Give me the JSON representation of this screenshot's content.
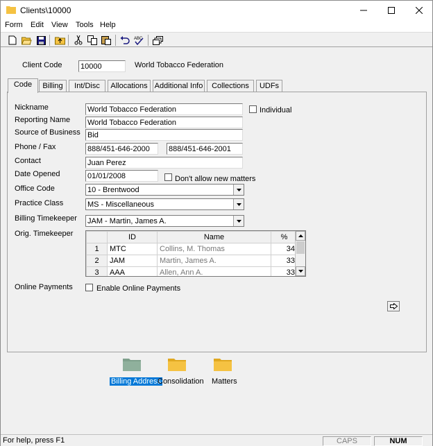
{
  "window": {
    "title": "Clients\\10000"
  },
  "menu": [
    "Form",
    "Edit",
    "View",
    "Tools",
    "Help"
  ],
  "header": {
    "client_code_label": "Client Code",
    "client_code_value": "10000",
    "client_name": "World Tobacco Federation"
  },
  "tabs": [
    "Code",
    "Billing",
    "Int/Disc",
    "Allocations",
    "Additional Info",
    "Collections",
    "UDFs"
  ],
  "form": {
    "nickname_label": "Nickname",
    "nickname_value": "World Tobacco Federation",
    "individual_label": "Individual",
    "reporting_label": "Reporting Name",
    "reporting_value": "World Tobacco Federation",
    "source_label": "Source of Business",
    "source_value": "Bid",
    "phone_label": "Phone / Fax",
    "phone_value": "888/451-646-2000",
    "fax_value": "888/451-646-2001",
    "contact_label": "Contact",
    "contact_value": "Juan Perez",
    "date_label": "Date Opened",
    "date_value": "01/01/2008",
    "dont_allow_label": "Don't allow new matters",
    "office_label": "Office Code",
    "office_value": "10 - Brentwood",
    "practice_label": "Practice Class",
    "practice_value": "MS - Miscellaneous",
    "billing_tk_label": "Billing Timekeeper",
    "billing_tk_value": "JAM - Martin, James A.",
    "orig_tk_label": "Orig. Timekeeper",
    "online_label": "Online Payments",
    "enable_online_label": "Enable Online Payments"
  },
  "grid": {
    "headers": [
      "ID",
      "Name",
      "%"
    ],
    "rows": [
      {
        "num": "1",
        "id": "MTC",
        "name": "Collins, M. Thomas",
        "pct": "34"
      },
      {
        "num": "2",
        "id": "JAM",
        "name": "Martin, James A.",
        "pct": "33"
      },
      {
        "num": "3",
        "id": "AAA",
        "name": "Allen, Ann A.",
        "pct": "33"
      }
    ]
  },
  "folders": [
    "Billing Address",
    "Consolidation",
    "Matters"
  ],
  "status": {
    "help": "For help, press F1",
    "caps": "CAPS",
    "num": "NUM"
  },
  "colors": {
    "folder_selected": "#7fa08c",
    "folder": "#f5c242",
    "selection": "#0078d7"
  }
}
